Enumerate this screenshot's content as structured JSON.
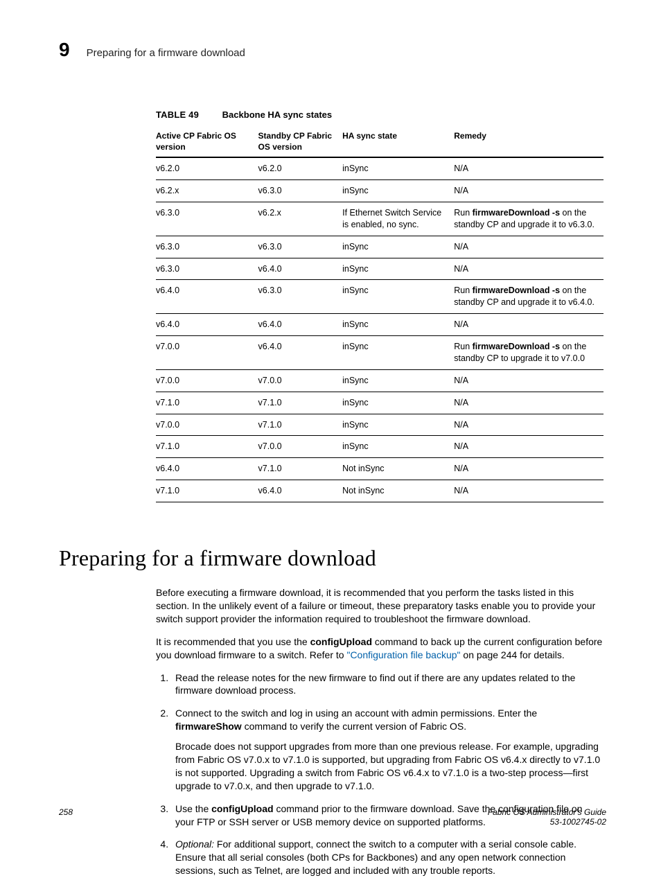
{
  "header": {
    "chapter_number": "9",
    "chapter_title": "Preparing for a firmware download"
  },
  "table": {
    "label": "TABLE 49",
    "title": "Backbone HA sync states",
    "columns": {
      "active": "Active CP Fabric OS version",
      "standby": "Standby CP Fabric OS version",
      "state": "HA sync state",
      "remedy": "Remedy"
    },
    "rows": [
      {
        "a": "v6.2.0",
        "b": "v6.2.0",
        "c": "inSync",
        "d": "N/A"
      },
      {
        "a": "v6.2.x",
        "b": "v6.3.0",
        "c": "inSync",
        "d": "N/A"
      },
      {
        "a": "v6.3.0",
        "b": "v6.2.x",
        "c": "If Ethernet Switch Service is enabled, no sync.",
        "d_pre": "Run ",
        "d_cmd": "firmwareDownload -s",
        "d_post": " on the standby CP and upgrade it to v6.3.0."
      },
      {
        "a": "v6.3.0",
        "b": "v6.3.0",
        "c": "inSync",
        "d": "N/A"
      },
      {
        "a": "v6.3.0",
        "b": "v6.4.0",
        "c": "inSync",
        "d": "N/A"
      },
      {
        "a": "v6.4.0",
        "b": "v6.3.0",
        "c": "inSync",
        "d_pre": "Run ",
        "d_cmd": "firmwareDownload -s",
        "d_post": " on the standby CP and upgrade it to v6.4.0."
      },
      {
        "a": "v6.4.0",
        "b": "v6.4.0",
        "c": "inSync",
        "d": "N/A"
      },
      {
        "a": "v7.0.0",
        "b": "v6.4.0",
        "c": "inSync",
        "d_pre": "Run ",
        "d_cmd": "firmwareDownload -s",
        "d_post": " on the standby CP to upgrade it to v7.0.0"
      },
      {
        "a": "v7.0.0",
        "b": "v7.0.0",
        "c": "inSync",
        "d": "N/A"
      },
      {
        "a": "v7.1.0",
        "b": "v7.1.0",
        "c": "inSync",
        "d": "N/A"
      },
      {
        "a": "v7.0.0",
        "b": "v7.1.0",
        "c": "inSync",
        "d": "N/A"
      },
      {
        "a": "v7.1.0",
        "b": "v7.0.0",
        "c": "inSync",
        "d": "N/A"
      },
      {
        "a": "v6.4.0",
        "b": "v7.1.0",
        "c": "Not inSync",
        "d": "N/A"
      },
      {
        "a": "v7.1.0",
        "b": "v6.4.0",
        "c": "Not inSync",
        "d": "N/A"
      }
    ]
  },
  "section": {
    "heading": "Preparing for a firmware download",
    "intro1": "Before executing a firmware download, it is recommended that you perform the tasks listed in this section. In the unlikely event of a failure or timeout, these preparatory tasks enable you to provide your switch support provider the information required to troubleshoot the firmware download.",
    "intro2_pre": "It is recommended that you use the ",
    "intro2_cmd": "configUpload",
    "intro2_mid": " command to back up the current configuration before you download firmware to a switch. Refer to ",
    "intro2_link": "\"Configuration file backup\"",
    "intro2_post": " on page 244 for details.",
    "steps": {
      "s1": "Read the release notes for the new firmware to find out if there are any updates related to the firmware download process.",
      "s2_pre": "Connect to the switch and log in using an account with admin permissions. Enter the ",
      "s2_cmd": "firmwareShow",
      "s2_post": " command to verify the current version of Fabric OS.",
      "s2_note": "Brocade does not support upgrades from more than one previous release. For example, upgrading from Fabric OS v7.0.x to v7.1.0 is supported, but upgrading from Fabric OS v6.4.x directly to v7.1.0 is not supported. Upgrading a switch from Fabric OS v6.4.x to v7.1.0 is a two-step process—first upgrade to v7.0.x, and then upgrade to v7.1.0.",
      "s3_pre": "Use the ",
      "s3_cmd": "configUpload",
      "s3_post": " command prior to the firmware download. Save the configuration file on your FTP or SSH server or USB memory device on supported platforms.",
      "s4_label": "Optional:",
      "s4_text": " For additional support, connect the switch to a computer with a serial console cable. Ensure that all serial consoles (both CPs for Backbones) and any open network connection sessions, such as Telnet, are logged and included with any trouble reports."
    }
  },
  "footer": {
    "page_number": "258",
    "doc_title": "Fabric OS Administrator's Guide",
    "doc_id": "53-1002745-02"
  }
}
